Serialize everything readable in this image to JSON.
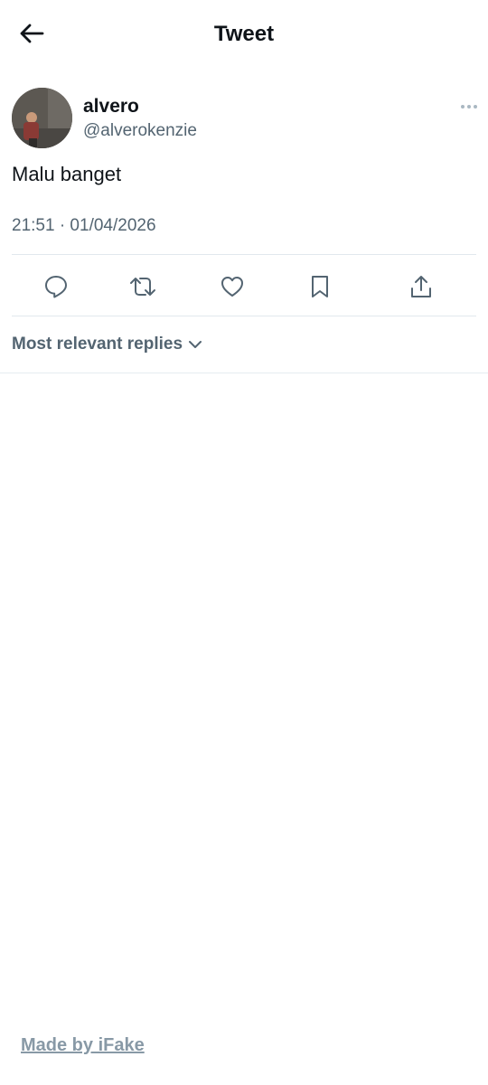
{
  "header": {
    "title": "Tweet",
    "back_icon": "arrow-left-icon"
  },
  "tweet": {
    "author_name": "alvero",
    "author_handle": "@alverokenzie",
    "text": "Malu banget",
    "timestamp": "21:51 · 01/04/2026",
    "more_icon": "ellipsis-icon"
  },
  "actions": [
    {
      "icon": "reply-icon"
    },
    {
      "icon": "retweet-icon"
    },
    {
      "icon": "like-icon"
    },
    {
      "icon": "bookmark-icon"
    },
    {
      "icon": "share-icon"
    }
  ],
  "replies": {
    "sort_label": "Most relevant replies",
    "chevron_icon": "chevron-down-icon"
  },
  "footer": {
    "made_by": "Made by iFake"
  },
  "colors": {
    "text": "#0f1419",
    "secondary": "#536471",
    "divider": "#e1e8ed",
    "footer": "#8899a6"
  }
}
